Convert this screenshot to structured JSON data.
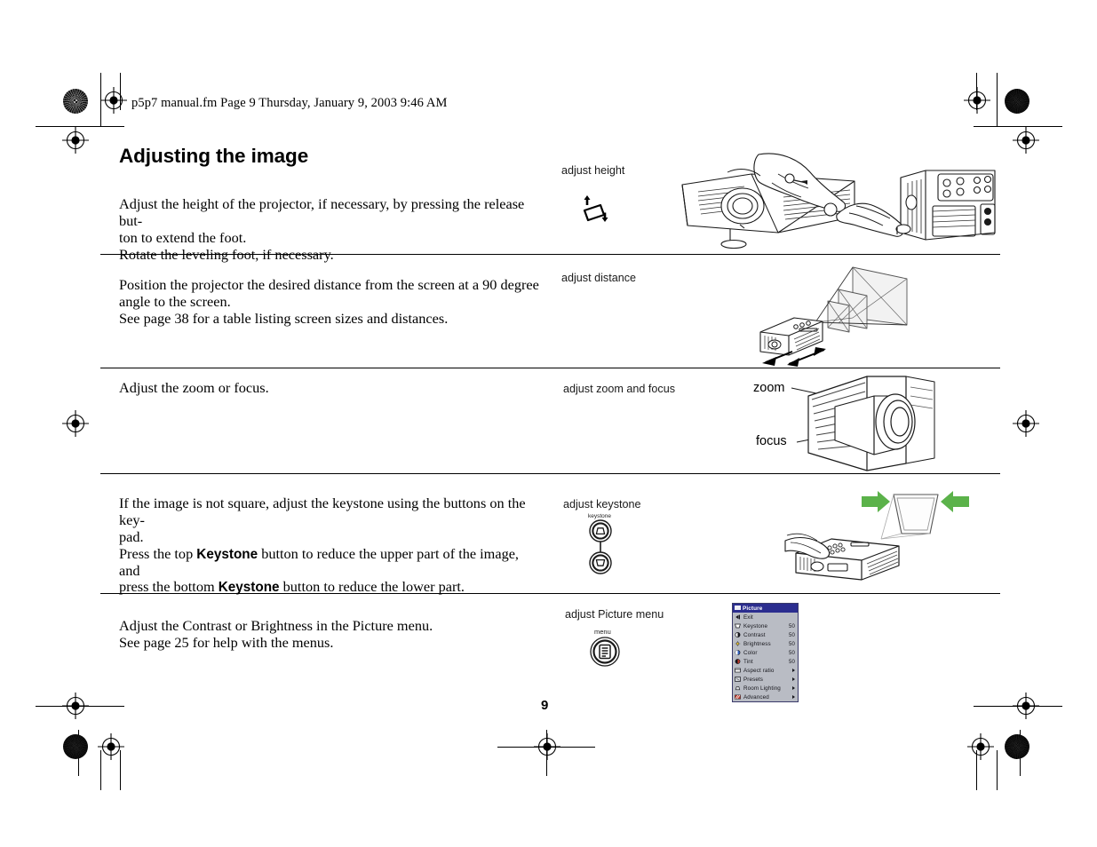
{
  "document": {
    "fm_header": "p5p7 manual.fm  Page 9  Thursday, January 9, 2003  9:46 AM",
    "title": "Adjusting the image",
    "page_number": "9"
  },
  "rows": [
    {
      "label": "adjust height",
      "icon": "tilt-rectangle-up-down-arrows-icon",
      "text_lines": [
        "Adjust the height of the projector, if necessary, by pressing the release but-",
        "ton to extend the foot.",
        "Rotate the leveling foot, if necessary."
      ],
      "illustration": "hand-pressing-release-button-on-projector-and-rotating-leveling-foot"
    },
    {
      "label": "adjust distance",
      "icon": "none",
      "text_lines": [
        "Position the projector the desired distance from the screen at a 90 degree",
        "angle to the screen.",
        "See page 38 for a table listing screen sizes and distances."
      ],
      "illustration": "projector-projecting-to-screens-at-varying-distances-with-double-arrow"
    },
    {
      "label": "adjust zoom and focus",
      "icon": "none",
      "text_lines": [
        "Adjust the zoom or focus."
      ],
      "illustration": "projector-lens-closeup-with-zoom-and-focus-rings",
      "callouts": [
        "zoom",
        "focus"
      ]
    },
    {
      "label": "adjust keystone",
      "icon": "keystone-buttons-icon",
      "icon_label": "keystone",
      "text_lines_rich": [
        [
          {
            "t": "If the image is not square, adjust the keystone using the buttons on the key-",
            "b": false
          }
        ],
        [
          {
            "t": "pad.",
            "b": false
          }
        ],
        [
          {
            "t": "Press the top ",
            "b": false
          },
          {
            "t": "Keystone",
            "b": true
          },
          {
            "t": " button to reduce the upper part of the image, and",
            "b": false
          }
        ],
        [
          {
            "t": "press the bottom ",
            "b": false
          },
          {
            "t": "Keystone",
            "b": true
          },
          {
            "t": " button to reduce the lower part.",
            "b": false
          }
        ]
      ],
      "illustration": "hand-pressing-keystone-buttons-with-trapezoid-image-and-green-arrows"
    },
    {
      "label": "adjust Picture menu",
      "icon": "menu-button-icon",
      "icon_label": "menu",
      "text_lines": [
        "Adjust the Contrast or Brightness in the Picture menu.",
        "See page 25 for help with the menus."
      ],
      "illustration": "picture-menu-osd-screenshot"
    }
  ],
  "osd_menu": {
    "title": "Picture",
    "items": [
      {
        "label": "Exit",
        "value": "",
        "submenu": false,
        "icon": "back-arrow-icon"
      },
      {
        "label": "Keystone",
        "value": "50",
        "submenu": false,
        "icon": "keystone-icon"
      },
      {
        "label": "Contrast",
        "value": "50",
        "submenu": false,
        "icon": "contrast-icon"
      },
      {
        "label": "Brightness",
        "value": "50",
        "submenu": false,
        "icon": "brightness-icon"
      },
      {
        "label": "Color",
        "value": "50",
        "submenu": false,
        "icon": "color-icon"
      },
      {
        "label": "Tint",
        "value": "50",
        "submenu": false,
        "icon": "tint-icon"
      },
      {
        "label": "Aspect ratio",
        "value": "",
        "submenu": true,
        "icon": "aspect-ratio-icon"
      },
      {
        "label": "Presets",
        "value": "",
        "submenu": true,
        "icon": "presets-icon"
      },
      {
        "label": "Room Lighting",
        "value": "",
        "submenu": true,
        "icon": "room-lighting-icon"
      },
      {
        "label": "Advanced",
        "value": "",
        "submenu": true,
        "icon": "advanced-icon"
      }
    ],
    "colors": {
      "header_bg": "#2b2d8f",
      "header_text": "#ffffff",
      "body_bg": "#b9bcc4",
      "text": "#16161c"
    }
  },
  "colors": {
    "arrow_green": "#5bb24a",
    "line_black": "#000000",
    "screen_fill": "#f2f2f2"
  }
}
